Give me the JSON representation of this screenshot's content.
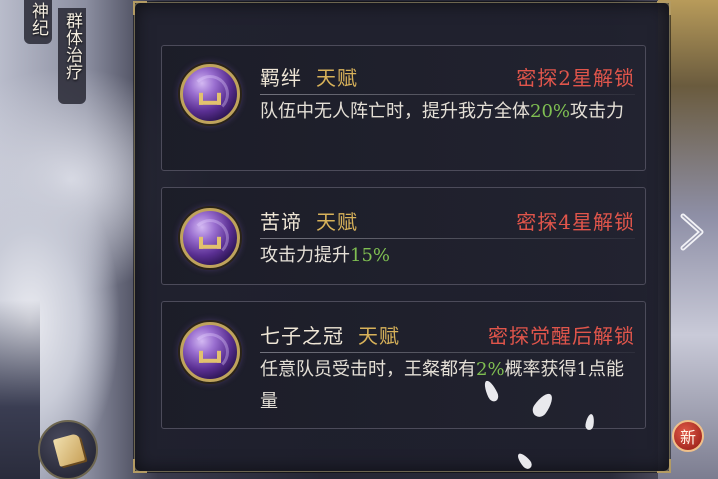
{
  "side_tabs": [
    {
      "label": "神纪"
    },
    {
      "label": "群体治疗"
    }
  ],
  "talents": [
    {
      "icon": "talent-swirl-icon",
      "name": "羁绊",
      "type": "天赋",
      "unlock": "密探2星解锁",
      "desc_before": "队伍中无人阵亡时，提升我方全体",
      "desc_highlight": "20%",
      "desc_after": "攻击力"
    },
    {
      "icon": "talent-swirl-icon",
      "name": "苦谛",
      "type": "天赋",
      "unlock": "密探4星解锁",
      "desc_before": "攻击力提升",
      "desc_highlight": "15%",
      "desc_after": ""
    },
    {
      "icon": "talent-swirl-icon",
      "name": "七子之冠",
      "type": "天赋",
      "unlock": "密探觉醒后解锁",
      "desc_before": "任意队员受击时，王粲都有",
      "desc_highlight": "2%",
      "desc_after": "概率获得1点能量"
    }
  ],
  "buttons": {
    "book_icon": "book-icon",
    "next_icon": "chevron-right-icon",
    "new_badge": "新"
  },
  "colors": {
    "unlock_red": "#e0554b",
    "type_gold": "#d8b25a",
    "highlight_green": "#7fbf52",
    "frame_gold": "#b39b63"
  }
}
